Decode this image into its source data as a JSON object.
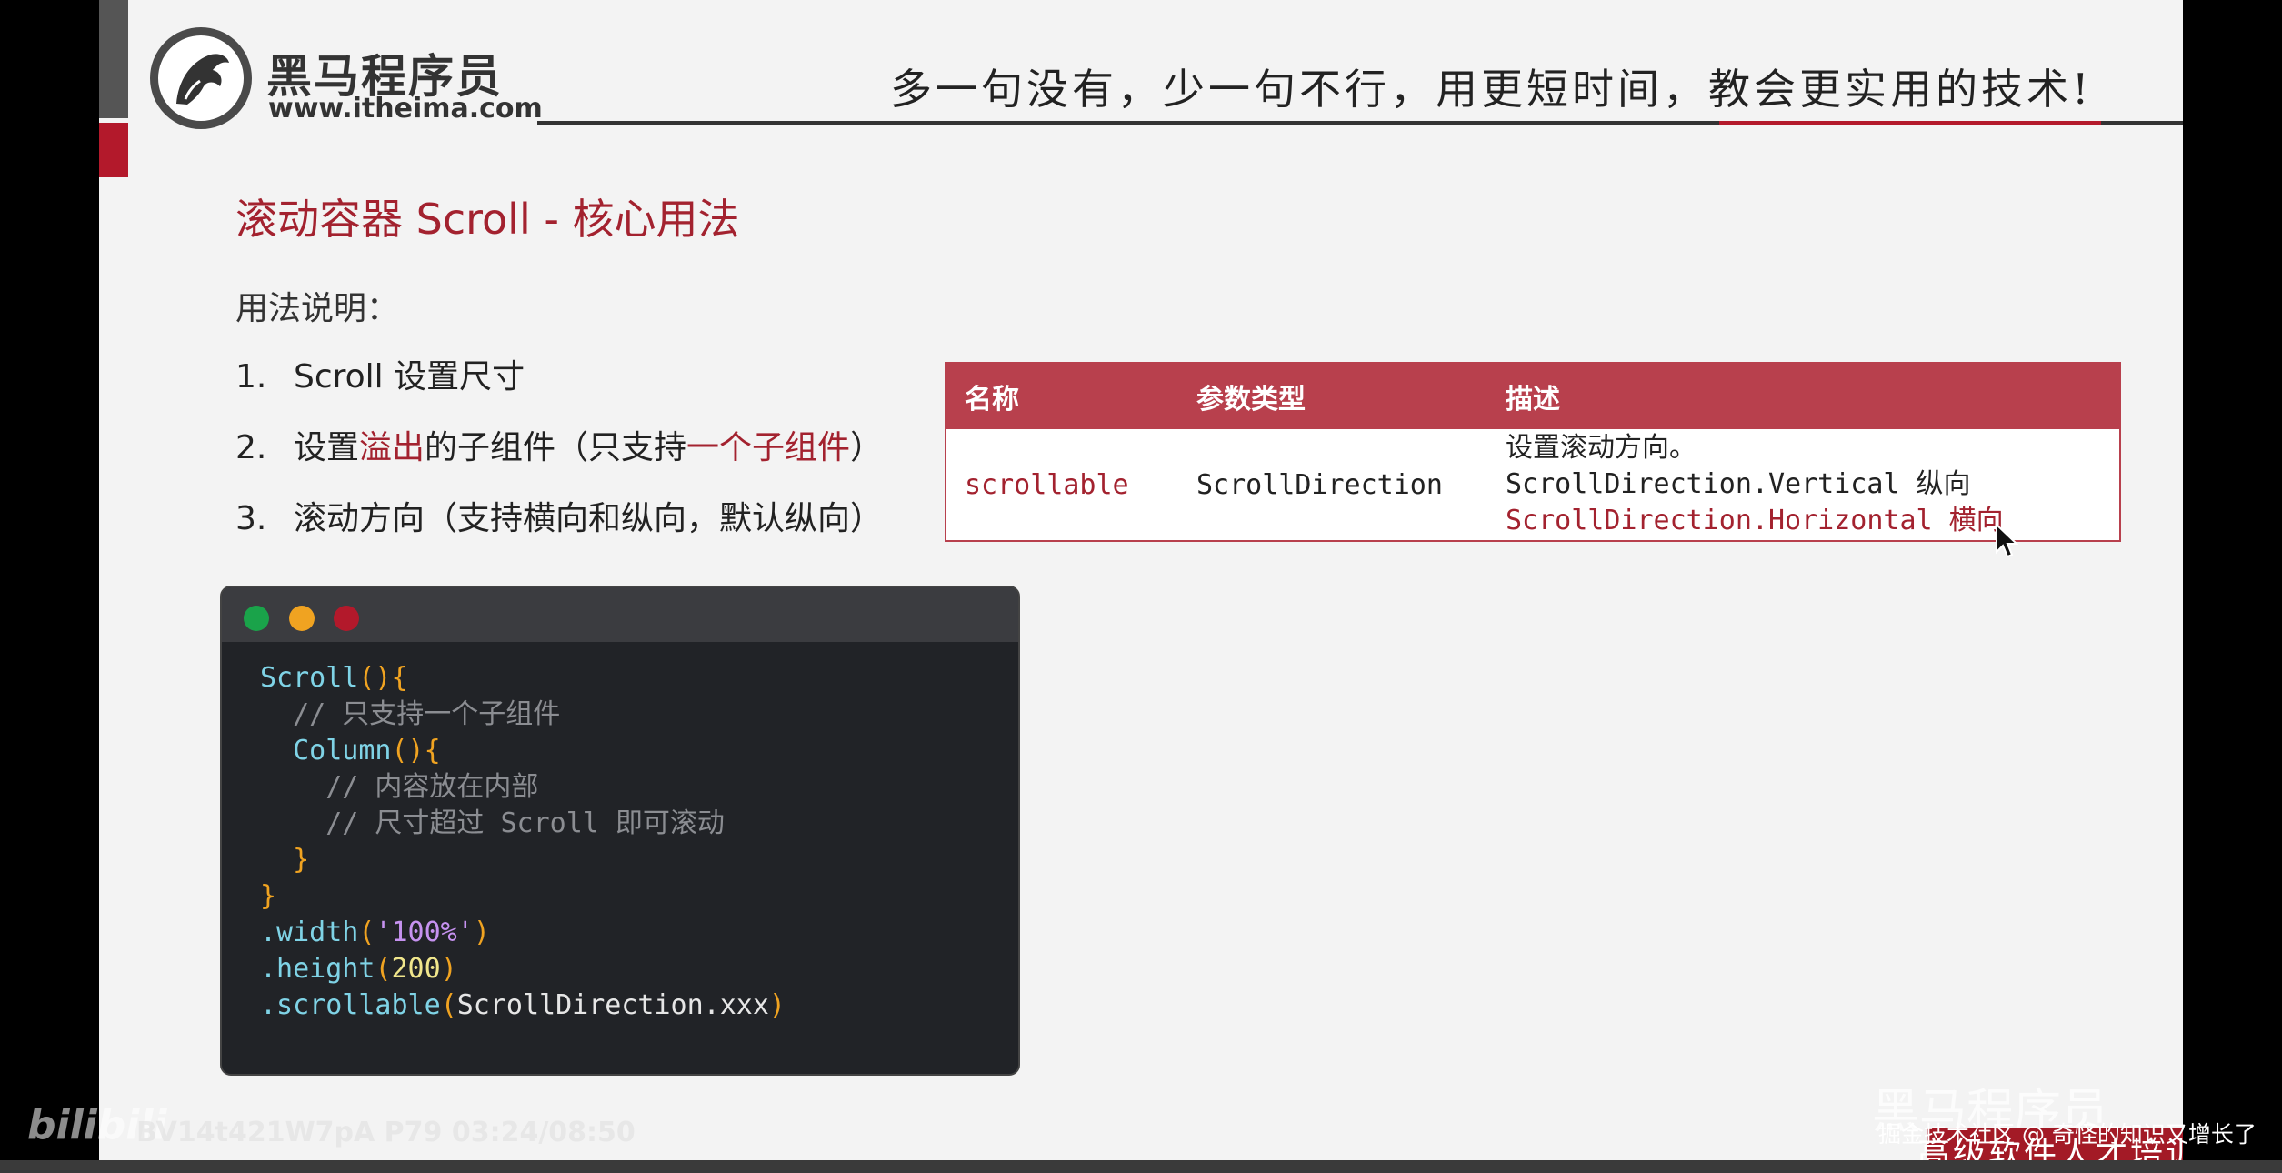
{
  "header": {
    "logo_name": "黑马程序员",
    "logo_url": "www.itheima.com",
    "slogan": "多一句没有，少一句不行，用更短时间，教会更实用的技术!"
  },
  "title": "滚动容器 Scroll - 核心用法",
  "subtitle": "用法说明：",
  "list": [
    {
      "num": "1.",
      "parts": [
        "Scroll 设置尺寸",
        "",
        ""
      ],
      "tail": ""
    },
    {
      "num": "2.",
      "pre": "设置",
      "hl1": "溢出",
      "mid": "的子组件（只支持",
      "hl2": "一个子组件",
      "post": "）"
    },
    {
      "num": "3.",
      "text": "滚动方向（支持横向和纵向，默认纵向）"
    }
  ],
  "table": {
    "headers": [
      "名称",
      "参数类型",
      "描述"
    ],
    "row": {
      "name": "scrollable",
      "type": "ScrollDirection",
      "desc": [
        "设置滚动方向。",
        "ScrollDirection.Vertical 纵向",
        "ScrollDirection.Horizontal 横向"
      ]
    }
  },
  "code": {
    "l1a": "Scroll",
    "l1b": "(){",
    "l2": "  // 只支持一个子组件",
    "l3a": "  Column",
    "l3b": "(){",
    "l4": "    // 内容放在内部",
    "l5": "    // 尺寸超过 Scroll 即可滚动",
    "l6": "  }",
    "l7": "}",
    "l8a": ".width",
    "l8b": "(",
    "l8c": "'100%'",
    "l8d": ")",
    "l9a": ".height",
    "l9b": "(",
    "l9c": "200",
    "l9d": ")",
    "l10a": ".scrollable",
    "l10b": "(",
    "l10c": "ScrollDirection.xxx",
    "l10d": ")"
  },
  "footer": {
    "brand": "高级软件人才培训专家",
    "heima_wm": "黑马程序员",
    "bili_logo": "bilibili",
    "video_id": "BV14t421W7pA P79 03:24/08:50",
    "juejin": "掘金技术社区 @ 奇怪的知识又增长了"
  },
  "colors": {
    "accent": "#a3222f",
    "table_header": "#b8404d",
    "code_bg": "#212327"
  }
}
